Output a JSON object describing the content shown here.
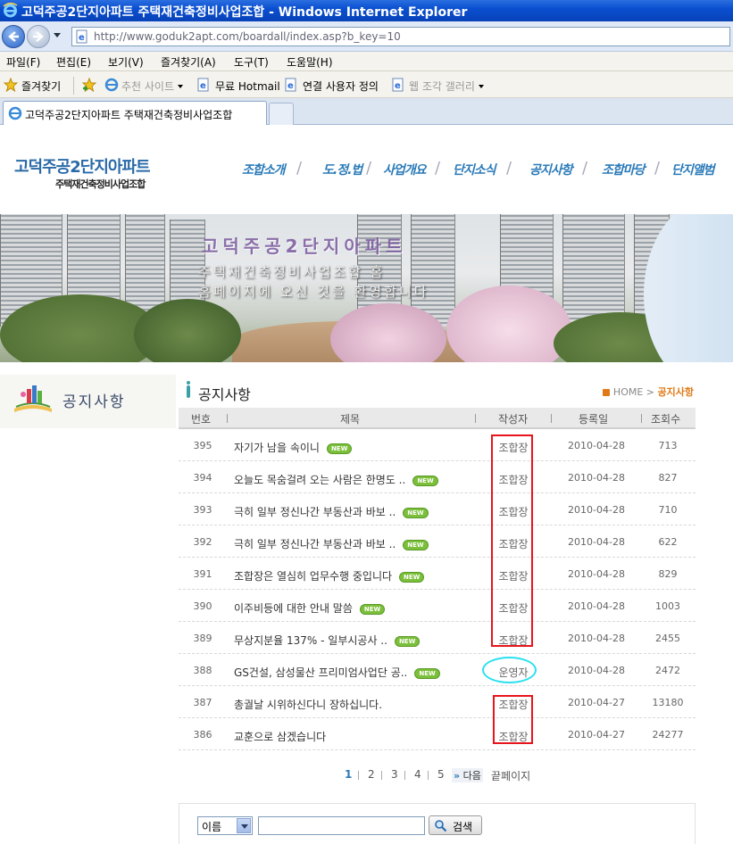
{
  "window": {
    "title": "고덕주공2단지아파트 주택재건축정비사업조합 - Windows Internet Explorer"
  },
  "browser": {
    "url": "http://www.goduk2apt.com/boardall/index.asp?b_key=10",
    "menu": [
      "파일(F)",
      "편집(E)",
      "보기(V)",
      "즐겨찾기(A)",
      "도구(T)",
      "도움말(H)"
    ],
    "favorites_label": "즐겨찾기",
    "fav_items": [
      "추천 사이트",
      "무료 Hotmail",
      "연결 사용자 정의",
      "웹 조각 갤러리"
    ],
    "tab_label": "고덕주공2단지아파트 주택재건축정비사업조합"
  },
  "site": {
    "logo_main": "고덕주공2단지아파트",
    "logo_sub": "주택재건축정비사업조합",
    "nav": [
      "조합소개",
      "도.정.법",
      "사업개요",
      "단지소식",
      "공지사항",
      "조합마당",
      "단지앨범"
    ],
    "banner_line1": "고덕주공2단지아파트",
    "banner_line2": "주택재건축정비사업조합 홈",
    "banner_line3": "홈페이지에 오신 것을 환영합니다",
    "side_title": "공지사항"
  },
  "board": {
    "title": "공지사항",
    "breadcrumb_home": "HOME",
    "breadcrumb_sep": ">",
    "breadcrumb_current": "공지사항",
    "columns": [
      "번호",
      "제목",
      "작성자",
      "등록일",
      "조회수"
    ],
    "new_badge": "NEW",
    "rows": [
      {
        "num": "395",
        "subject": "자기가 남을 속이니",
        "author": "조합장",
        "date": "2010-04-28",
        "hits": "713",
        "new": true
      },
      {
        "num": "394",
        "subject": "오늘도 목숨걸려 오는 사람은 한명도 ..",
        "author": "조합장",
        "date": "2010-04-28",
        "hits": "827",
        "new": true
      },
      {
        "num": "393",
        "subject": "극히 일부 정신나간 부동산과 바보 ..",
        "author": "조합장",
        "date": "2010-04-28",
        "hits": "710",
        "new": true
      },
      {
        "num": "392",
        "subject": "극히 일부 정신나간 부동산과 바보 ..",
        "author": "조합장",
        "date": "2010-04-28",
        "hits": "622",
        "new": true
      },
      {
        "num": "391",
        "subject": "조합장은 열심히 업무수행 중입니다",
        "author": "조합장",
        "date": "2010-04-28",
        "hits": "829",
        "new": true
      },
      {
        "num": "390",
        "subject": "이주비등에 대한 안내 말씀",
        "author": "조합장",
        "date": "2010-04-28",
        "hits": "1003",
        "new": true
      },
      {
        "num": "389",
        "subject": "무상지분율 137% - 일부시공사 ..",
        "author": "조합장",
        "date": "2010-04-28",
        "hits": "2455",
        "new": true
      },
      {
        "num": "388",
        "subject": "GS건설, 삼성물산 프리미엄사업단 공..",
        "author": "운영자",
        "date": "2010-04-28",
        "hits": "2472",
        "new": true
      },
      {
        "num": "387",
        "subject": "총궐날 시위하신다니 장하십니다.",
        "author": "조합장",
        "date": "2010-04-27",
        "hits": "13180",
        "new": false
      },
      {
        "num": "386",
        "subject": "교훈으로 삼겠습니다",
        "author": "조합장",
        "date": "2010-04-27",
        "hits": "24277",
        "new": false
      }
    ],
    "pages": [
      "1",
      "2",
      "3",
      "4",
      "5"
    ],
    "next_label": "다음",
    "last_label": "끝페이지",
    "search": {
      "select_value": "이름",
      "input_value": "",
      "button_label": "검색"
    }
  },
  "colors": {
    "accent": "#2a7ab8",
    "highlight_red": "#e8141c",
    "highlight_cyan": "#28e0f0",
    "crumb_orange": "#e07a18"
  }
}
